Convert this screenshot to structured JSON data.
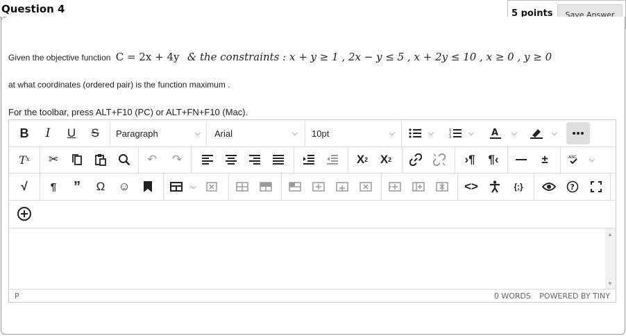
{
  "question": {
    "title": "Question 4",
    "points": "5 points",
    "save_label": "Save Answer",
    "line1_prefix": "Given the objective function",
    "math_objective": "C = 2x + 4y",
    "math_constraints": "& the constraints : x + y ≥ 1 , 2x − y ≤ 5 , x + 2y ≤ 10 , x ≥ 0 , y ≥ 0",
    "line2": "at what coordinates (ordered pair) is  the function  maximum .",
    "toolbar_hint": "For the toolbar, press ALT+F10 (PC) or ALT+FN+F10 (Mac)."
  },
  "editor": {
    "block_format": "Paragraph",
    "font_family": "Arial",
    "font_size": "10pt",
    "toolbar_row1": [
      "bold-icon",
      "italic-icon",
      "underline-icon",
      "strikethrough-icon",
      "bullet-list-icon",
      "numbered-list-icon",
      "text-color-icon",
      "highlight-icon",
      "more-icon"
    ],
    "toolbar_row2": [
      "clear-format-icon",
      "cut-icon",
      "copy-icon",
      "paste-icon",
      "find-icon",
      "undo-icon",
      "redo-icon",
      "align-left-icon",
      "align-center-icon",
      "align-right-icon",
      "justify-icon",
      "indent-icon",
      "outdent-icon",
      "superscript-icon",
      "subscript-icon",
      "link-icon",
      "unlink-icon",
      "ltr-icon",
      "rtl-icon",
      "horizontal-rule-icon",
      "plus-minus-icon",
      "spellcheck-icon"
    ],
    "toolbar_row3": [
      "math-icon",
      "pilcrow-icon",
      "quote-icon",
      "omega-icon",
      "emoji-icon",
      "bookmark-icon",
      "table-icon",
      "delete-table-icon",
      "row-props-icon",
      "cell-props-icon",
      "insert-row-before-icon",
      "insert-row-after-icon",
      "insert-col-before-icon",
      "delete-row-icon",
      "insert-col-after-icon",
      "insert-col-icon",
      "delete-col-icon",
      "code-icon",
      "accessibility-icon",
      "source-code-icon",
      "preview-icon",
      "help-icon",
      "fullscreen-icon"
    ],
    "toolbar_row4": [
      "add-content-icon"
    ],
    "status_path": "P",
    "word_count": "0 WORDS",
    "powered_by": "POWERED BY TINY"
  }
}
